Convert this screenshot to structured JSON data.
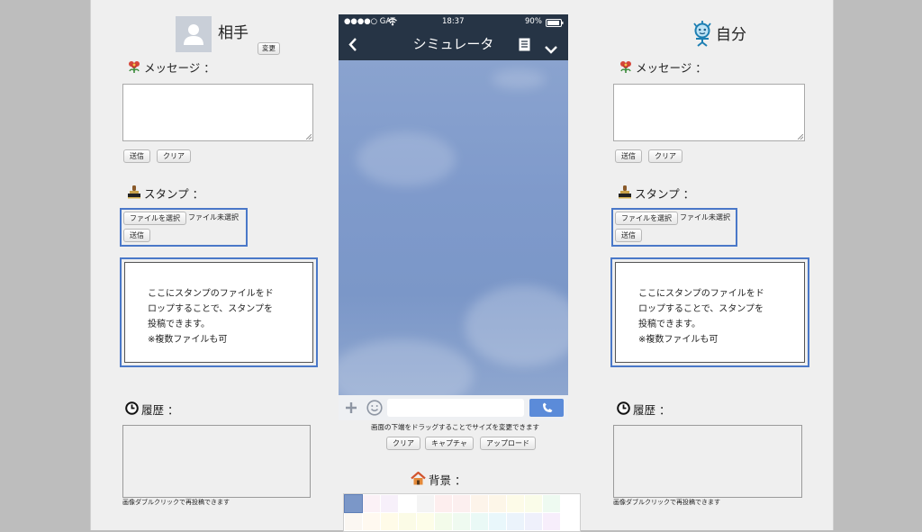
{
  "partner": {
    "name": "相手",
    "change_label": "変更",
    "message_label": "メッセージ ：",
    "send_label": "送信",
    "clear_label": "クリア",
    "stamp_label": "スタンプ ：",
    "choose_file_label": "ファイルを選択",
    "file_status": "ファイル未選択",
    "stamp_send_label": "送信",
    "drop_text": "ここにスタンプのファイルをド\nロップすることで、スタンプを\n投稿できます。\n※複数ファイルも可",
    "history_label": "履歴 ：",
    "history_note": "画像ダブルクリックで再投稿できます"
  },
  "self": {
    "name": "自分",
    "message_label": "メッセージ ：",
    "send_label": "送信",
    "clear_label": "クリア",
    "stamp_label": "スタンプ ：",
    "choose_file_label": "ファイルを選択",
    "file_status": "ファイル未選択",
    "stamp_send_label": "送信",
    "drop_text": "ここにスタンプのファイルをド\nロップすることで、スタンプを\n投稿できます。\n※複数ファイルも可",
    "history_label": "履歴 ：",
    "history_note": "画像ダブルクリックで再投稿できます"
  },
  "phone": {
    "carrier": "●●●●○ GAT",
    "time": "18:37",
    "battery": "90%",
    "title": "シミュレータ",
    "resize_hint": "画面の下端をドラッグすることでサイズを変更できます",
    "clear_label": "クリア",
    "capture_label": "キャプチャ",
    "upload_label": "アップロード"
  },
  "background": {
    "label": "背景 ：",
    "swatches": [
      "#7b97c8",
      "#fbf1f6",
      "#f7f0fa",
      "#ffffff",
      "#f4f4f4",
      "#fdeeee",
      "#fcefef",
      "#fdf4ea",
      "#fdf6e8",
      "#fdfbe8",
      "#fafce9",
      "#eefaf1",
      "#fbf7f2",
      "#fff9f0",
      "#fffbe8",
      "#fbfbe6",
      "#fdfde8",
      "#f3fbea",
      "#effaf0",
      "#eaf9f6",
      "#e9f7fb",
      "#ebf3fb",
      "#eff0fb",
      "#f7eefb"
    ]
  },
  "colors": {
    "accent_border": "#4a78c8",
    "phone_header": "#263445",
    "chat_background": "#7b97c8",
    "call_button": "#5b8bd9"
  }
}
